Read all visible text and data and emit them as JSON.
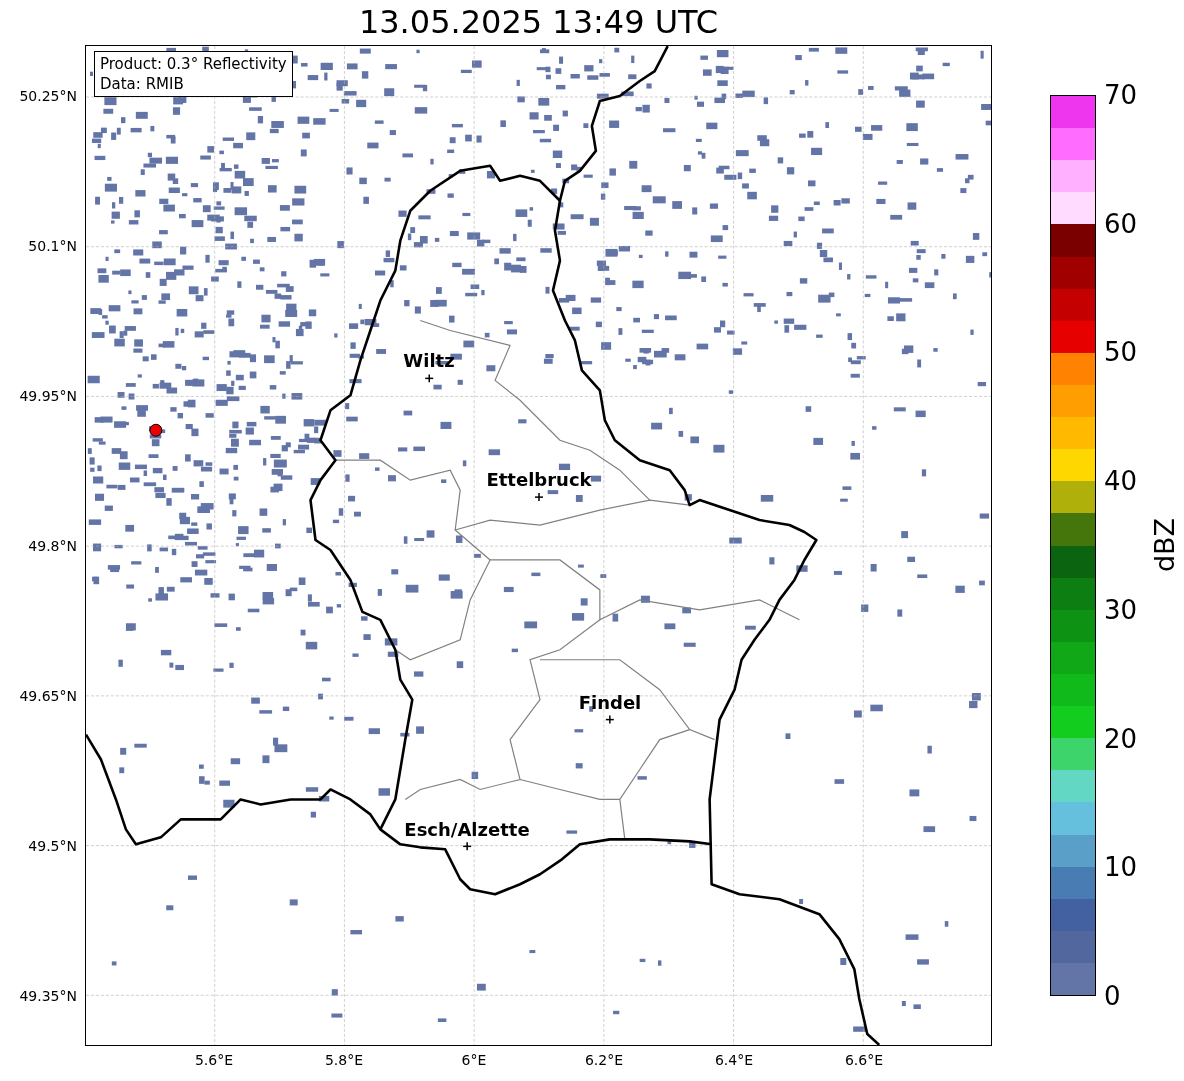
{
  "title": "13.05.2025 13:49 UTC",
  "info_box": [
    "Product: 0.3° Reflectivity",
    "Data: RMIB"
  ],
  "x_ticks": [
    "5.6°E",
    "5.8°E",
    "6°E",
    "6.2°E",
    "6.4°E",
    "6.6°E"
  ],
  "y_ticks": [
    "50.25°N",
    "50.1°N",
    "49.95°N",
    "49.8°N",
    "49.65°N",
    "49.5°N",
    "49.35°N"
  ],
  "cities": [
    {
      "name": "Wiltz"
    },
    {
      "name": "Ettelbruck"
    },
    {
      "name": "Findel"
    },
    {
      "name": "Esch/Alzette"
    }
  ],
  "colorbar": {
    "label": "dBZ",
    "ticks": [
      "70",
      "60",
      "50",
      "40",
      "30",
      "20",
      "10",
      "0"
    ],
    "segments": [
      {
        "color": "#ee36ee"
      },
      {
        "color": "#ff6cff"
      },
      {
        "color": "#ffb0ff"
      },
      {
        "color": "#ffdcff"
      },
      {
        "color": "#7a0000"
      },
      {
        "color": "#a00000"
      },
      {
        "color": "#c40000"
      },
      {
        "color": "#e60000"
      },
      {
        "color": "#ff8200"
      },
      {
        "color": "#ff9e00"
      },
      {
        "color": "#ffba00"
      },
      {
        "color": "#ffd700"
      },
      {
        "color": "#b0b00a"
      },
      {
        "color": "#44760c"
      },
      {
        "color": "#0a6410"
      },
      {
        "color": "#0c7e12"
      },
      {
        "color": "#0e9214"
      },
      {
        "color": "#10a816"
      },
      {
        "color": "#10ba1a"
      },
      {
        "color": "#12cc1e"
      },
      {
        "color": "#3dd46c"
      },
      {
        "color": "#62d8c4"
      },
      {
        "color": "#64c0dc"
      },
      {
        "color": "#5a9fc8"
      },
      {
        "color": "#4a7cb4"
      },
      {
        "color": "#4360a0"
      },
      {
        "color": "#52679e"
      },
      {
        "color": "#6374a7"
      }
    ]
  }
}
